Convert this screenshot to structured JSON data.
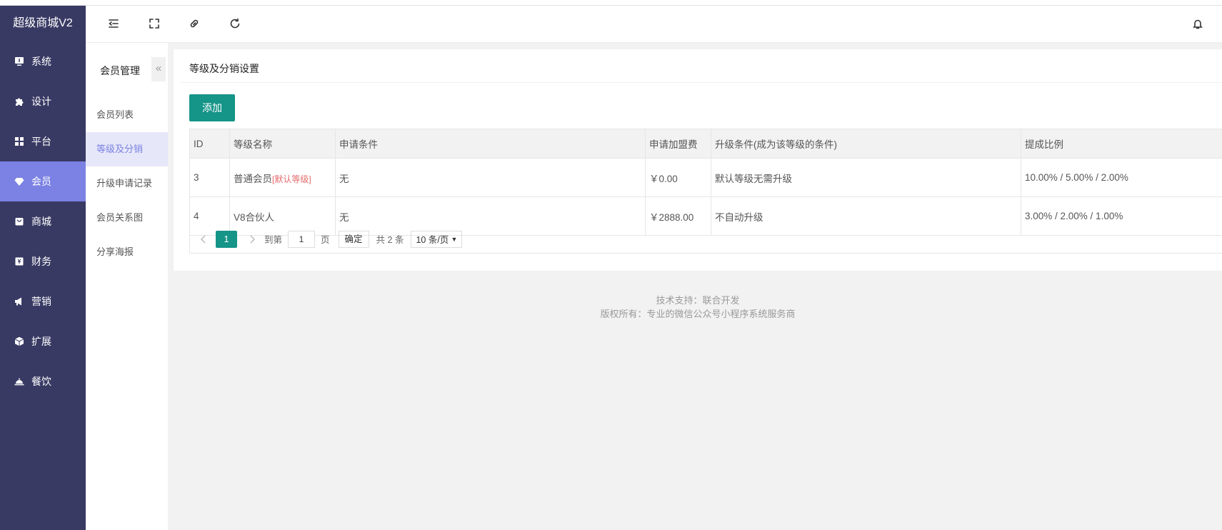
{
  "app": {
    "brand": "超级商城V2"
  },
  "sidebar": {
    "items": [
      {
        "label": "系统",
        "icon": "monitor-icon"
      },
      {
        "label": "设计",
        "icon": "puzzle-icon"
      },
      {
        "label": "平台",
        "icon": "grid-icon"
      },
      {
        "label": "会员",
        "icon": "diamond-icon",
        "active": true
      },
      {
        "label": "商城",
        "icon": "bag-icon"
      },
      {
        "label": "财务",
        "icon": "wallet-icon"
      },
      {
        "label": "营销",
        "icon": "megaphone-icon"
      },
      {
        "label": "扩展",
        "icon": "cube-icon"
      },
      {
        "label": "餐饮",
        "icon": "food-cover-icon"
      }
    ]
  },
  "header": {
    "icons": [
      "menu-collapse-icon",
      "fullscreen-icon",
      "link-icon",
      "refresh-icon",
      "bell-icon"
    ]
  },
  "submenu": {
    "title": "会员管理",
    "collapse_glyph": "«",
    "items": [
      {
        "label": "会员列表"
      },
      {
        "label": "等级及分销",
        "active": true
      },
      {
        "label": "升级申请记录"
      },
      {
        "label": "会员关系图"
      },
      {
        "label": "分享海报"
      }
    ]
  },
  "main": {
    "title": "等级及分销设置",
    "add_button": "添加",
    "table": {
      "headers": [
        "ID",
        "等级名称",
        "申请条件",
        "申请加盟费",
        "升级条件(成为该等级的条件)",
        "提成比例"
      ],
      "rows": [
        {
          "id": "3",
          "name": "普通会员",
          "tag": "[默认等级]",
          "condition": "无",
          "fee": "￥0.00",
          "upgrade": "默认等级无需升级",
          "ratio": "10.00% / 5.00% / 2.00%"
        },
        {
          "id": "4",
          "name": "V8合伙人",
          "tag": "",
          "condition": "无",
          "fee": "￥2888.00",
          "upgrade": "不自动升级",
          "ratio": "3.00% / 2.00% / 1.00%"
        }
      ]
    },
    "pager": {
      "current": "1",
      "goto_prefix": "到第",
      "goto_value": "1",
      "goto_suffix": "页",
      "confirm": "确定",
      "total": "共 2 条",
      "page_size": "10 条/页"
    }
  },
  "footer": {
    "line1": "技术支持：联合开发",
    "line2": "版权所有：专业的微信公众号小程序系统服务商"
  },
  "colors": {
    "sidebar_bg": "#393a64",
    "sidebar_active": "#7b82e3",
    "primary": "#159488",
    "tag_red": "#e46a6a"
  }
}
